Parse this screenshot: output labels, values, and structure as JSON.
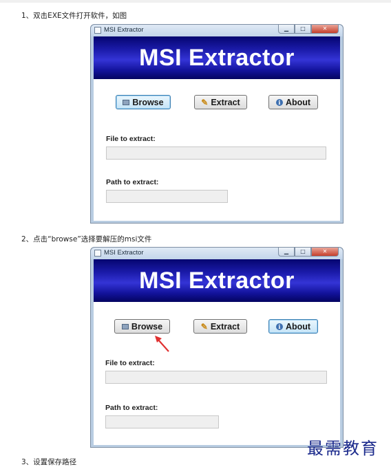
{
  "steps": [
    "1、双击EXE文件打开软件，如图",
    "2、点击“browse”选择要解压的msi文件",
    "3、设置保存路径"
  ],
  "window": {
    "title": "MSI Extractor",
    "banner": "MSI Extractor",
    "controls": {
      "minimize": "▁",
      "maximize": "□",
      "close": "✕"
    }
  },
  "buttons": {
    "browse": "Browse",
    "extract": "Extract",
    "about": "About"
  },
  "labels": {
    "file_to_extract": "File to extract:",
    "path_to_extract": "Path to extract:"
  },
  "fields": {
    "file_to_extract": "",
    "path_to_extract": ""
  },
  "icons": {
    "browse": "folder-icon",
    "extract": "wand-icon",
    "about": "info-icon"
  },
  "colors": {
    "banner_dark": "#050570",
    "banner_mid": "#3434d6",
    "annotation_arrow": "#e03030",
    "watermark": "#1b2a8c"
  },
  "watermark": "最需教育"
}
